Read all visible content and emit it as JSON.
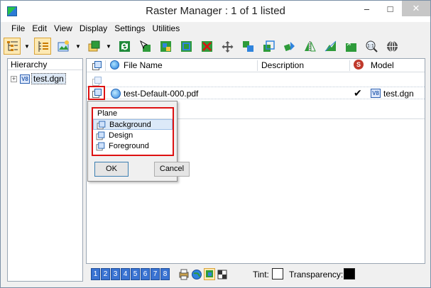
{
  "window": {
    "title": "Raster Manager : 1 of 1 listed"
  },
  "menu": [
    {
      "label": "File"
    },
    {
      "label": "Edit"
    },
    {
      "label": "View"
    },
    {
      "label": "Display"
    },
    {
      "label": "Settings"
    },
    {
      "label": "Utilities"
    }
  ],
  "toolbar": {
    "buttons": [
      "hierarchy-view-icon",
      "list-view-icon",
      "attach-raster-icon",
      "attach-options-icon",
      "reload-icon",
      "select-raster-icon",
      "clip-icon",
      "clip-boundary-icon",
      "detach-icon",
      "move-icon",
      "copy-icon",
      "scale-icon",
      "rotate-icon",
      "mirror-icon",
      "warp-icon",
      "fit-icon",
      "magnifier-11-icon",
      "globe-icon"
    ]
  },
  "hierarchy": {
    "header": "Hierarchy",
    "items": [
      {
        "label": "test.dgn",
        "expander": "+"
      }
    ]
  },
  "list": {
    "columns": {
      "file_name": "File Name",
      "description": "Description",
      "model": "Model"
    },
    "rows": [
      {
        "file_name": "test-Default-000.pdf",
        "description": "",
        "check": "✔",
        "model": "test.dgn"
      }
    ]
  },
  "plane_popup": {
    "header": "Plane",
    "options": [
      {
        "label": "Background",
        "selected": true
      },
      {
        "label": "Design",
        "selected": false
      },
      {
        "label": "Foreground",
        "selected": false
      }
    ],
    "ok_label": "OK",
    "cancel_label": "Cancel"
  },
  "statusbar": {
    "views": [
      "1",
      "2",
      "3",
      "4",
      "5",
      "6",
      "7",
      "8"
    ],
    "tint_label": "Tint:",
    "transparency_label": "Transparency:",
    "tint_color": "#ffffff",
    "transparency_color": "#000000"
  }
}
